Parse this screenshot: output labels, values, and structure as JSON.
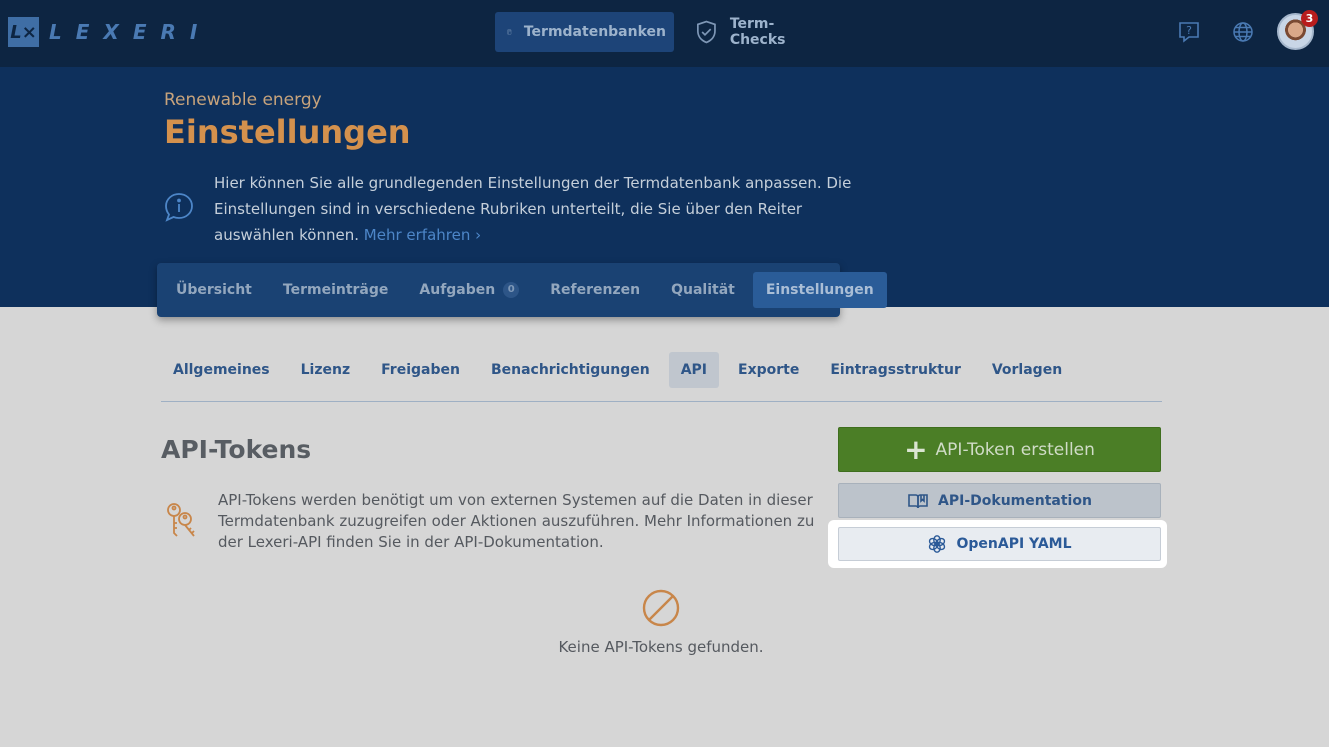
{
  "brand": {
    "logo_mark": "L×",
    "name": "LEXERI"
  },
  "topnav": {
    "items": [
      {
        "label": "Termdatenbanken",
        "icon": "book-icon",
        "active": true
      },
      {
        "label": "Term-Checks",
        "icon": "shield-check-icon",
        "active": false
      }
    ],
    "help_icon": "help-icon",
    "language_icon": "globe-icon",
    "notification_count": "3"
  },
  "header": {
    "subtitle": "Renewable energy",
    "title": "Einstellungen",
    "info_text": "Hier können Sie alle grundlegenden Einstellungen der Termdatenbank anpassen. Die Einstellungen sind in verschiedene Rubriken unterteilt, die Sie über den Reiter auswählen können.",
    "info_link": "Mehr erfahren"
  },
  "main_tabs": [
    {
      "label": "Übersicht"
    },
    {
      "label": "Termeinträge"
    },
    {
      "label": "Aufgaben",
      "count": "0"
    },
    {
      "label": "Referenzen"
    },
    {
      "label": "Qualität"
    },
    {
      "label": "Einstellungen",
      "active": true
    }
  ],
  "sub_tabs": [
    {
      "label": "Allgemeines"
    },
    {
      "label": "Lizenz"
    },
    {
      "label": "Freigaben"
    },
    {
      "label": "Benachrichtigungen"
    },
    {
      "label": "API",
      "active": true
    },
    {
      "label": "Exporte"
    },
    {
      "label": "Eintragsstruktur"
    },
    {
      "label": "Vorlagen"
    }
  ],
  "api_section": {
    "title": "API-Tokens",
    "description": "API-Tokens werden benötigt um von externen Systemen auf die Daten in dieser Termdatenbank zuzugreifen oder Aktionen auszuführen. Mehr Informationen zu der Lexeri-API finden Sie in der API-Dokumentation.",
    "create_button": "API-Token erstellen",
    "docs_button": "API-Dokumentation",
    "yaml_button": "OpenAPI YAML",
    "empty_text": "Keine API-Tokens gefunden."
  },
  "colors": {
    "topbar": "#0d2542",
    "hero": "#0e305c",
    "accent_orange": "#d4914d",
    "create_green": "#4b7e26",
    "link_blue": "#2f5688"
  }
}
